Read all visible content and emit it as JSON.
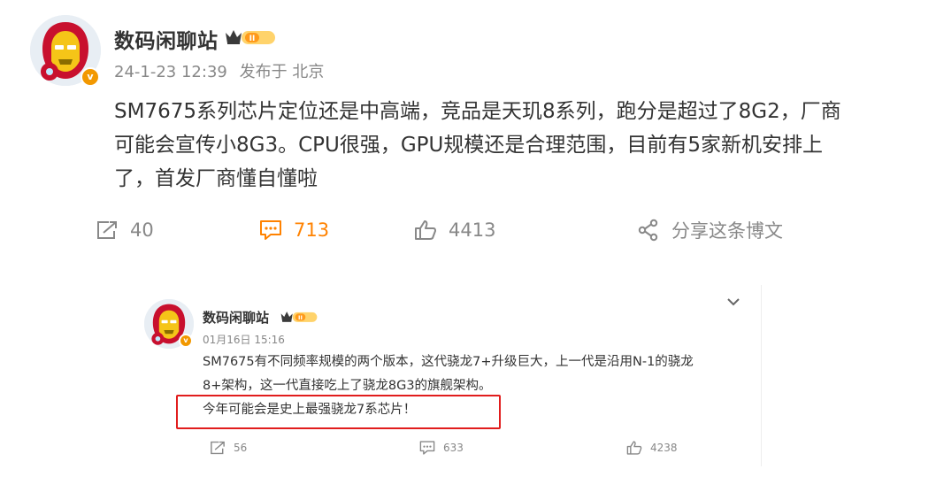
{
  "post": {
    "username": "数码闲聊站",
    "badge_text": "II",
    "timestamp": "24-1-23 12:39",
    "source": "发布于 北京",
    "paragraph_lines": [
      "SM7675系列芯片定位还是中高端，竞品是天玑8系列，跑分是超过了8G2，厂商",
      "可能会宣传小8G3。CPU很强，GPU规模还是合理范围，目前有5家新机安排上",
      "了，首发厂商懂自懂啦"
    ],
    "actions": {
      "repost_count": "40",
      "comment_count": "713",
      "like_count": "4413",
      "share_label": "分享这条博文"
    }
  },
  "embedded": {
    "username": "数码闲聊站",
    "badge_text": "II",
    "timestamp": "01月16日 15:16",
    "lines": [
      "SM7675有不同频率规模的两个版本，这代骁龙7+升级巨大，上一代是沿用N-1的骁龙",
      "8+架构，这一代直接吃上了骁龙8G3的旗舰架构。",
      "今年可能会是史上最强骁龙7系芯片！"
    ],
    "actions": {
      "repost_count": "56",
      "comment_count": "633",
      "like_count": "4238"
    }
  },
  "colors": {
    "accent_orange": "#ff8200",
    "highlight_red": "#e11d1d",
    "verified_orange": "#f29800",
    "meta_gray": "#888888"
  },
  "icons": [
    "repost-icon",
    "comment-icon",
    "like-icon",
    "share-icon",
    "chevron-down-icon",
    "crown-badge-icon",
    "verified-icon"
  ]
}
